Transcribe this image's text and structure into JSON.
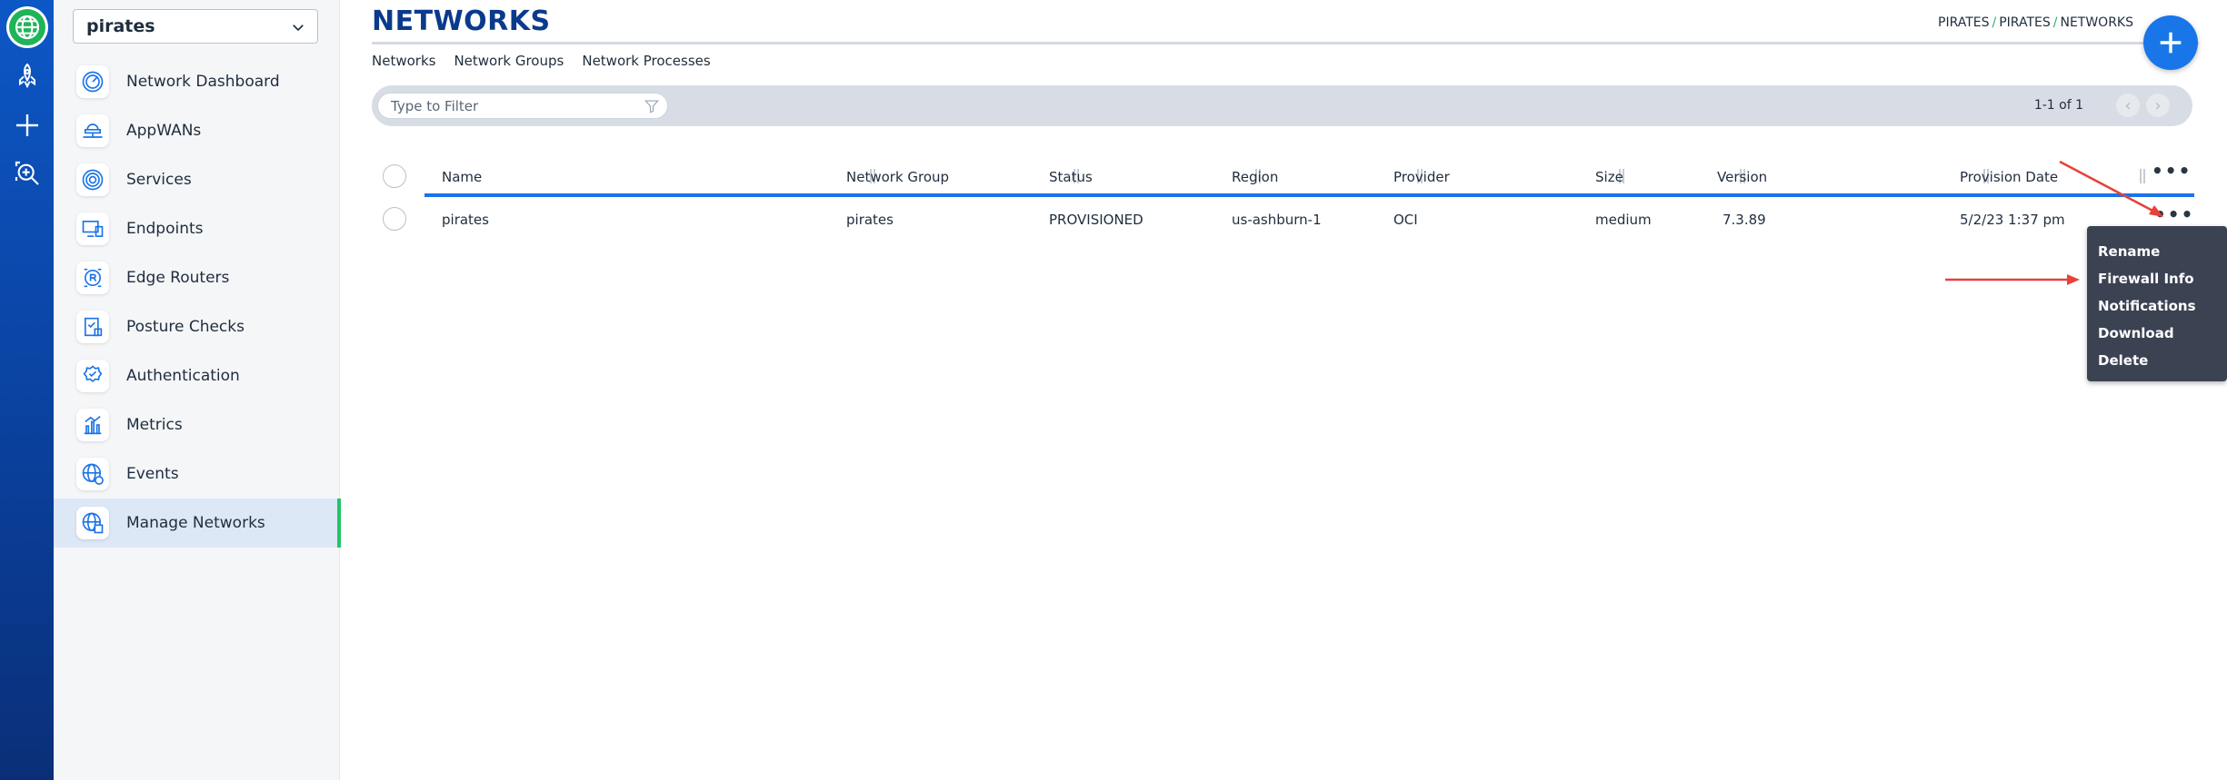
{
  "rail": {
    "icons": [
      "globe-icon",
      "rocket-icon",
      "plus-icon",
      "search-icon"
    ]
  },
  "sidebar": {
    "network_select": "pirates",
    "items": [
      {
        "label": "Network Dashboard",
        "icon": "gauge-icon"
      },
      {
        "label": "AppWANs",
        "icon": "cloud-network-icon"
      },
      {
        "label": "Services",
        "icon": "fingerprint-icon"
      },
      {
        "label": "Endpoints",
        "icon": "devices-icon"
      },
      {
        "label": "Edge Routers",
        "icon": "router-icon"
      },
      {
        "label": "Posture Checks",
        "icon": "clipboard-check-icon"
      },
      {
        "label": "Authentication",
        "icon": "badge-check-icon"
      },
      {
        "label": "Metrics",
        "icon": "bar-chart-icon"
      },
      {
        "label": "Events",
        "icon": "globe-clock-icon"
      },
      {
        "label": "Manage Networks",
        "icon": "globe-settings-icon"
      }
    ],
    "active_index": 9
  },
  "header": {
    "title": "NETWORKS",
    "breadcrumb": [
      "PIRATES",
      "PIRATES",
      "NETWORKS"
    ],
    "breadcrumb_sep": "/"
  },
  "tabs": [
    "Networks",
    "Network Groups",
    "Network Processes"
  ],
  "filter": {
    "placeholder": "Type to Filter",
    "pager_text": "1-1 of 1"
  },
  "table": {
    "columns": [
      "Name",
      "Network Group",
      "Status",
      "Region",
      "Provider",
      "Size",
      "Version",
      "Provision Date"
    ],
    "rows": [
      {
        "name": "pirates",
        "network_group": "pirates",
        "status": "PROVISIONED",
        "region": "us-ashburn-1",
        "provider": "OCI",
        "size": "medium",
        "version": "7.3.89",
        "provision_date": "5/2/23 1:37 pm"
      }
    ]
  },
  "row_menu": {
    "items": [
      "Rename",
      "Firewall Info",
      "Notifications",
      "Download",
      "Delete"
    ]
  },
  "colors": {
    "accent": "#1a73e8",
    "rail": "#0d57c6",
    "active_bar": "#23c46a",
    "menu_bg": "#3b4252",
    "annotation_arrow": "#e8403a"
  }
}
